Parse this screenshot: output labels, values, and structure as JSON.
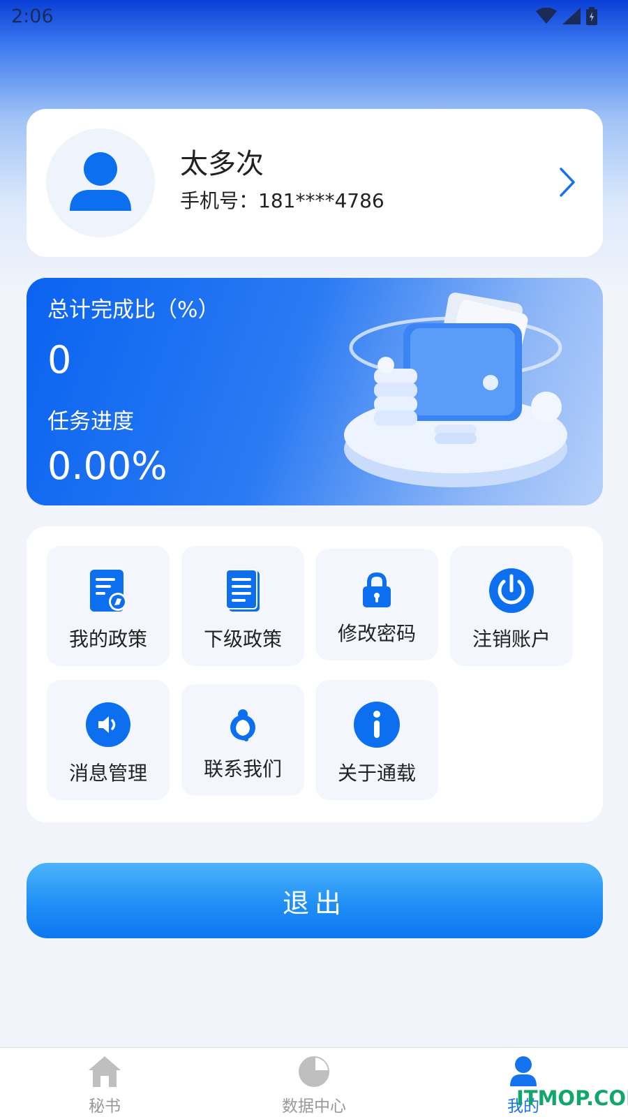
{
  "status_bar": {
    "time": "2:06"
  },
  "profile": {
    "name": "太多次",
    "phone": "手机号：181****4786"
  },
  "progress": {
    "completion_label": "总计完成比（%）",
    "completion_value": "0",
    "task_label": "任务进度",
    "task_value": "0.00%"
  },
  "menu": {
    "items": [
      {
        "label": "我的政策",
        "icon": "document-icon"
      },
      {
        "label": "下级政策",
        "icon": "notebook-icon"
      },
      {
        "label": "修改密码",
        "icon": "lock-icon"
      },
      {
        "label": "注销账户",
        "icon": "power-icon"
      },
      {
        "label": "消息管理",
        "icon": "speaker-icon"
      },
      {
        "label": "联系我们",
        "icon": "headset-icon"
      },
      {
        "label": "关于通载",
        "icon": "info-icon"
      }
    ]
  },
  "logout_label": "退出",
  "bottom_nav": {
    "items": [
      {
        "label": "秘书",
        "icon": "home-icon",
        "active": false
      },
      {
        "label": "数据中心",
        "icon": "pie-chart-icon",
        "active": false
      },
      {
        "label": "我的",
        "icon": "user-icon",
        "active": true
      }
    ]
  },
  "watermark": "ITMOP.COM",
  "colors": {
    "accent": "#1673f0",
    "icon_blue": "#0b6ff0",
    "page_bg": "#f1f4fb"
  }
}
